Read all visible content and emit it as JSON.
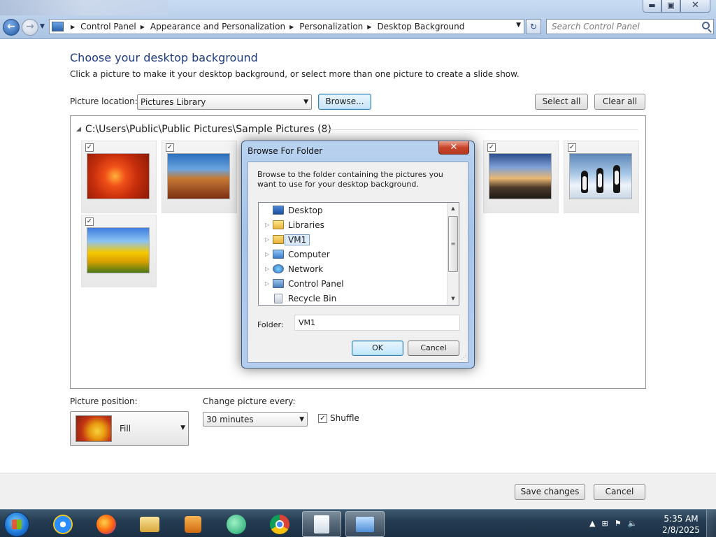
{
  "window": {
    "controls": {
      "minimize": "▬",
      "maximize": "▣",
      "close": "✕"
    }
  },
  "address": {
    "breadcrumbs": [
      "Control Panel",
      "Appearance and Personalization",
      "Personalization",
      "Desktop Background"
    ],
    "search_placeholder": "Search Control Panel"
  },
  "main": {
    "heading": "Choose your desktop background",
    "subtitle": "Click a picture to make it your desktop background, or select more than one picture to create a slide show.",
    "picture_location_label": "Picture location:",
    "picture_location_value": "Pictures Library",
    "browse_button": "Browse...",
    "select_all_button": "Select all",
    "clear_all_button": "Clear all",
    "gallery": {
      "group_title": "C:\\Users\\Public\\Public Pictures\\Sample Pictures (8)",
      "pictures": [
        {
          "name": "chrysanthemum",
          "checked": true
        },
        {
          "name": "desert",
          "checked": true
        },
        {
          "name": "lighthouse",
          "checked": true
        },
        {
          "name": "penguins",
          "checked": true
        },
        {
          "name": "tulips",
          "checked": true
        }
      ]
    },
    "picture_position_label": "Picture position:",
    "picture_position_value": "Fill",
    "change_every_label": "Change picture every:",
    "change_every_value": "30 minutes",
    "shuffle_label": "Shuffle",
    "shuffle_checked": true,
    "save_button": "Save changes",
    "cancel_button": "Cancel"
  },
  "dialog": {
    "title": "Browse For Folder",
    "description": "Browse to the folder containing the pictures you want to use for your desktop background.",
    "tree": [
      {
        "label": "Desktop",
        "icon": "desktop-icon",
        "expandable": false,
        "selected": false
      },
      {
        "label": "Libraries",
        "icon": "libraries-icon",
        "expandable": true,
        "selected": false
      },
      {
        "label": "VM1",
        "icon": "user-folder-icon",
        "expandable": true,
        "selected": true
      },
      {
        "label": "Computer",
        "icon": "computer-icon",
        "expandable": true,
        "selected": false
      },
      {
        "label": "Network",
        "icon": "network-icon",
        "expandable": true,
        "selected": false
      },
      {
        "label": "Control Panel",
        "icon": "control-panel-icon",
        "expandable": true,
        "selected": false
      },
      {
        "label": "Recycle Bin",
        "icon": "recycle-bin-icon",
        "expandable": false,
        "selected": false
      }
    ],
    "folder_label": "Folder:",
    "folder_value": "VM1",
    "ok_button": "OK",
    "cancel_button": "Cancel"
  },
  "taskbar": {
    "items": [
      "start-button",
      "internet-explorer",
      "firefox",
      "windows-explorer",
      "media-player",
      "messenger",
      "chrome",
      "document-window",
      "control-panel-window"
    ],
    "active_item": "control-panel-window",
    "time": "5:35 AM",
    "date": "2/8/2025"
  }
}
